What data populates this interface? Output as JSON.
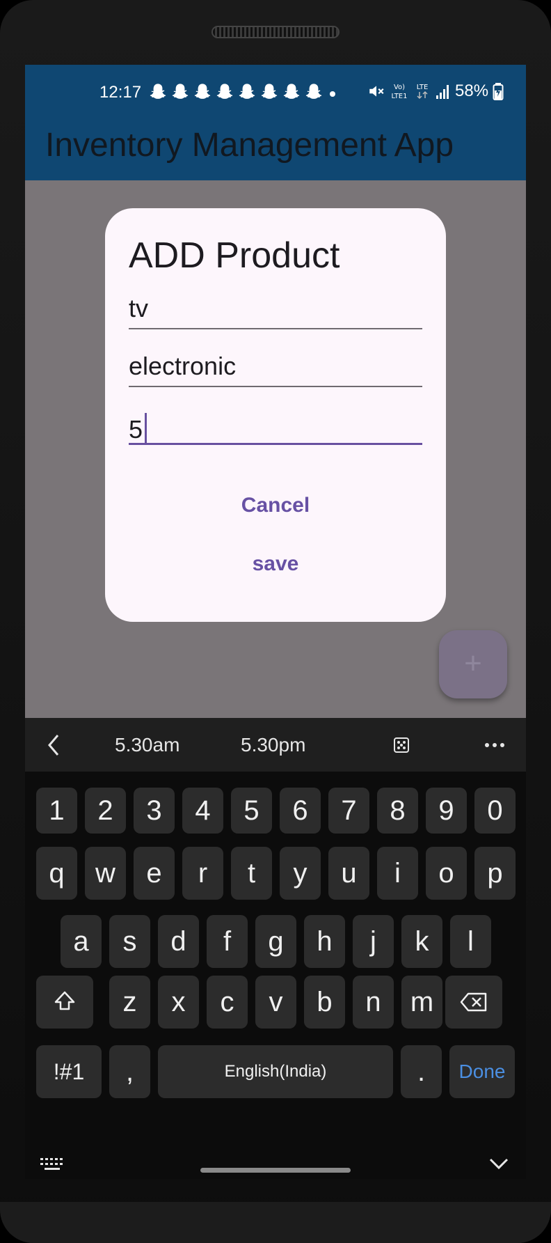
{
  "status_bar": {
    "time": "12:17",
    "battery": "58%",
    "icons": [
      "snapchat-icon",
      "snapchat-icon",
      "snapchat-icon",
      "snapchat-icon",
      "snapchat-icon",
      "snapchat-icon",
      "snapchat-icon",
      "snapchat-icon",
      "mute-icon",
      "volte-icon",
      "lte-icon",
      "signal-icon",
      "battery-icon"
    ]
  },
  "app_bar": {
    "title": "Inventory Management App"
  },
  "dialog": {
    "title": "ADD Product",
    "fields": [
      {
        "value": "tv"
      },
      {
        "value": "electronic"
      },
      {
        "value": "5"
      }
    ],
    "cancel_label": "Cancel",
    "save_label": "save"
  },
  "fab": {
    "icon": "plus-icon",
    "label": "+"
  },
  "keyboard": {
    "suggestions": [
      "5.30am",
      "5.30pm"
    ],
    "number_row": [
      "1",
      "2",
      "3",
      "4",
      "5",
      "6",
      "7",
      "8",
      "9",
      "0"
    ],
    "row1": [
      "q",
      "w",
      "e",
      "r",
      "t",
      "y",
      "u",
      "i",
      "o",
      "p"
    ],
    "row2": [
      "a",
      "s",
      "d",
      "f",
      "g",
      "h",
      "j",
      "k",
      "l"
    ],
    "row3": [
      "z",
      "x",
      "c",
      "v",
      "b",
      "n",
      "m"
    ],
    "symbols_label": "!#1",
    "comma_label": ",",
    "space_label": "English(India)",
    "period_label": ".",
    "done_label": "Done",
    "accent_color": "#4b8fe2"
  },
  "colors": {
    "app_bar": "#0f4772",
    "dialog_bg": "#fdf6fc",
    "primary": "#6751a4",
    "scrim": "#7a7578"
  }
}
